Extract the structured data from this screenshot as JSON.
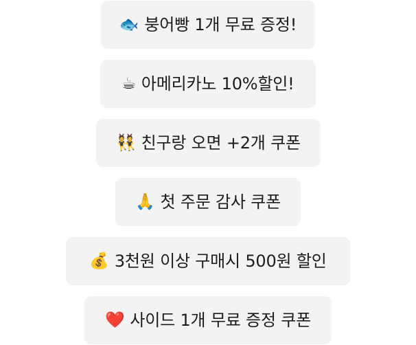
{
  "coupons": [
    {
      "icon": "fish-icon",
      "glyph": "🐟",
      "label": "붕어빵 1개 무료 증정!"
    },
    {
      "icon": "coffee-icon",
      "glyph": "☕",
      "label": "아메리카노 10%할인!"
    },
    {
      "icon": "friends-icon",
      "glyph": "👯",
      "label": "친구랑 오면 +2개 쿠폰"
    },
    {
      "icon": "folded-hands-icon",
      "glyph": "🙏",
      "label": "첫 주문 감사 쿠폰"
    },
    {
      "icon": "money-bag-icon",
      "glyph": "💰",
      "label": "3천원 이상 구매시 500원 할인"
    },
    {
      "icon": "heart-icon",
      "glyph": "❤️",
      "label": "사이드 1개 무료 증정 쿠폰"
    }
  ]
}
